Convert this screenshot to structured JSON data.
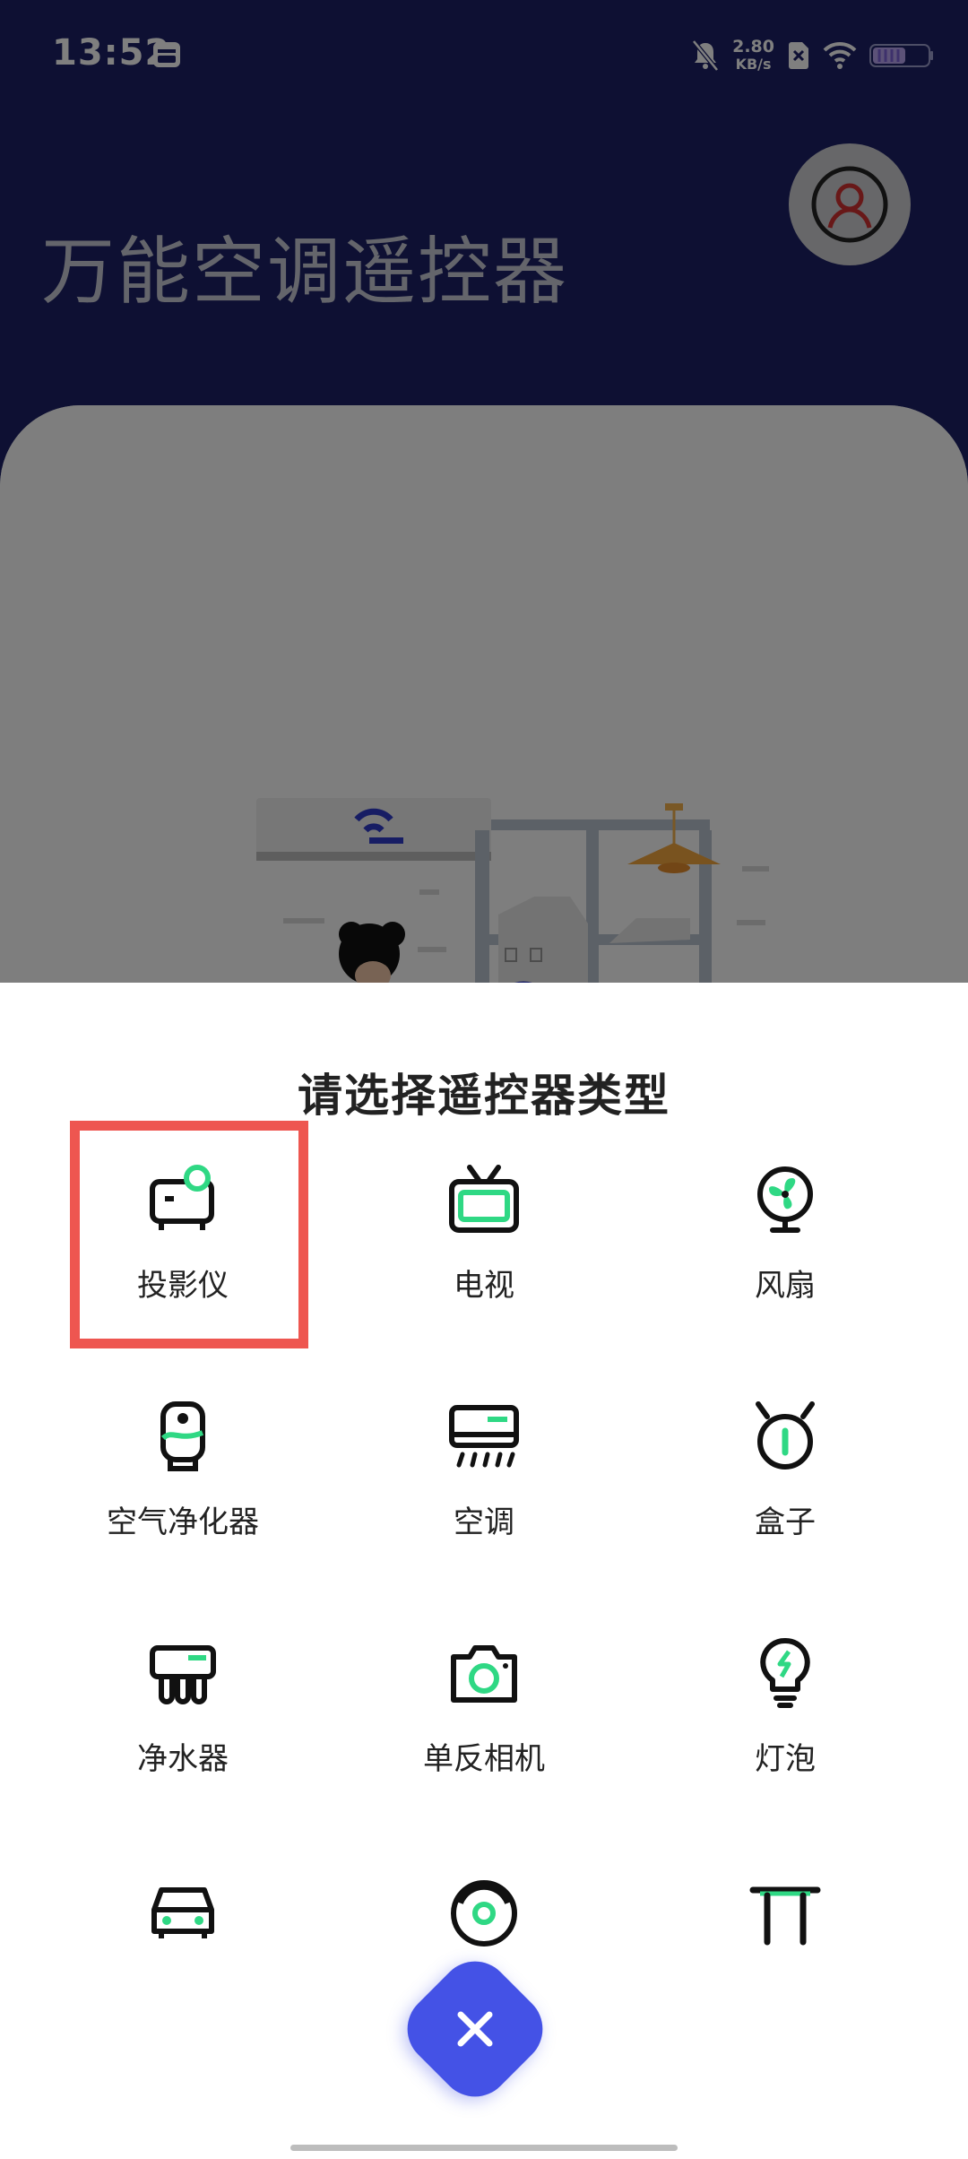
{
  "status_bar": {
    "time": "13:52",
    "net_speed_value": "2.80",
    "net_speed_unit": "KB/s",
    "icons": [
      "calendar-icon",
      "mute-bell-icon",
      "sim-off-icon",
      "wifi-icon",
      "battery-icon"
    ]
  },
  "app": {
    "title": "万能空调遥控器",
    "avatar_icon": "user-icon",
    "header_color": "#1c2166"
  },
  "sheet": {
    "title": "请选择遥控器类型",
    "accent_color": "#2fd884",
    "highlight_color": "#ee5650",
    "close_icon": "close-icon",
    "close_button_color": "#4452e6",
    "items": [
      {
        "label": "投影仪",
        "icon": "projector-icon"
      },
      {
        "label": "电视",
        "icon": "tv-icon"
      },
      {
        "label": "风扇",
        "icon": "fan-icon"
      },
      {
        "label": "空气净化器",
        "icon": "air-purifier-icon"
      },
      {
        "label": "空调",
        "icon": "air-conditioner-icon"
      },
      {
        "label": "盒子",
        "icon": "tv-box-icon"
      },
      {
        "label": "净水器",
        "icon": "water-purifier-icon"
      },
      {
        "label": "单反相机",
        "icon": "camera-icon"
      },
      {
        "label": "灯泡",
        "icon": "light-bulb-icon"
      },
      {
        "label": "",
        "icon": "car-icon"
      },
      {
        "label": "",
        "icon": "robot-vacuum-icon"
      },
      {
        "label": "",
        "icon": "table-icon"
      }
    ]
  }
}
